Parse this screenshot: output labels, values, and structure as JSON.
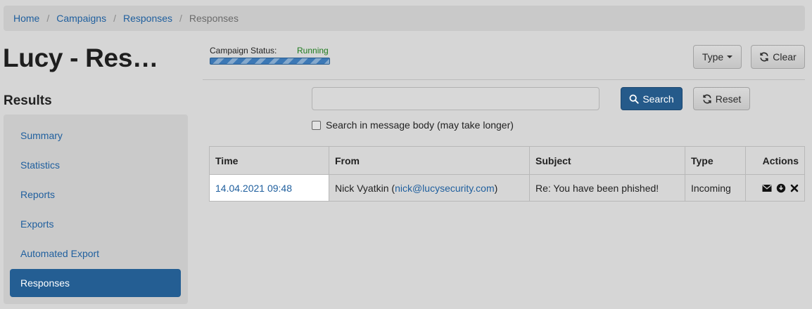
{
  "breadcrumb": {
    "home": "Home",
    "campaigns": "Campaigns",
    "responses_link": "Responses",
    "current": "Responses"
  },
  "page": {
    "title": "Lucy - Res…"
  },
  "campaign_status": {
    "label": "Campaign Status:",
    "value": "Running",
    "value_color": "#1d7a1d"
  },
  "toolbar": {
    "type_label": "Type",
    "clear_label": "Clear"
  },
  "sidebar": {
    "heading": "Results",
    "items": [
      {
        "label": "Summary"
      },
      {
        "label": "Statistics"
      },
      {
        "label": "Reports"
      },
      {
        "label": "Exports"
      },
      {
        "label": "Automated Export"
      },
      {
        "label": "Responses",
        "active": true
      }
    ]
  },
  "search": {
    "value": "",
    "placeholder": "",
    "search_label": "Search",
    "reset_label": "Reset",
    "body_checkbox_label": "Search in message body (may take longer)",
    "body_checkbox_checked": false
  },
  "table": {
    "headers": {
      "time": "Time",
      "from": "From",
      "subject": "Subject",
      "type": "Type",
      "actions": "Actions"
    },
    "rows": [
      {
        "time": "14.04.2021 09:48",
        "from_name": "Nick Vyatkin (",
        "from_email": "nick@lucysecurity.com",
        "from_close": ")",
        "subject": "Re: You have been phished!",
        "type": "Incoming"
      }
    ]
  },
  "colors": {
    "accent": "#245e93",
    "link": "#1f5f9e",
    "background": "#d6d6d6"
  }
}
